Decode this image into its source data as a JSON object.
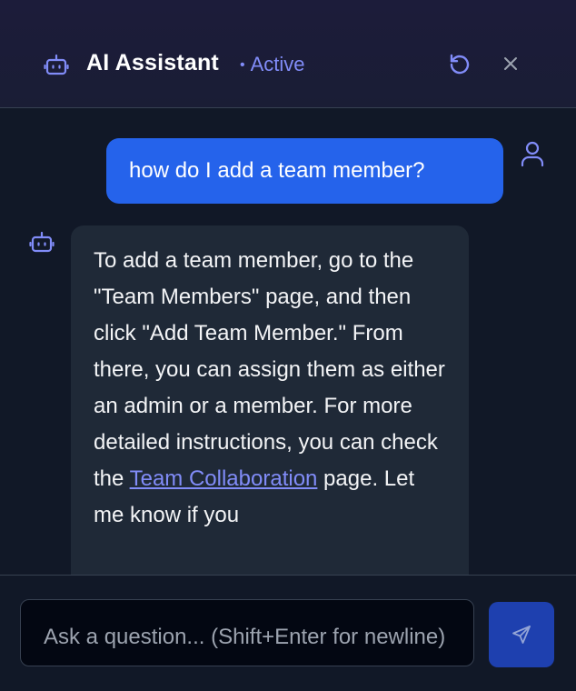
{
  "header": {
    "title": "AI Assistant",
    "status": "Active",
    "icons": {
      "assistant": "robot-icon",
      "reset": "refresh-icon",
      "close": "close-icon"
    }
  },
  "conversation": {
    "user_message": "how do I add a team member?",
    "assistant_message": {
      "part1": "To add a team member, go to the \"Team Members\" page, and then click \"Add Team Member.\" From there, you can assign them as either an admin or a member. For more detailed instructions, you can check the ",
      "link_text": "Team Collaboration",
      "part2": " page. Let me know if you"
    }
  },
  "composer": {
    "placeholder": "Ask a question... (Shift+Enter for newline)",
    "send_icon": "send-icon"
  },
  "colors": {
    "accent": "#818cf8",
    "user_bubble": "#2563eb",
    "assistant_bubble": "#1f2937",
    "background": "#111827"
  }
}
